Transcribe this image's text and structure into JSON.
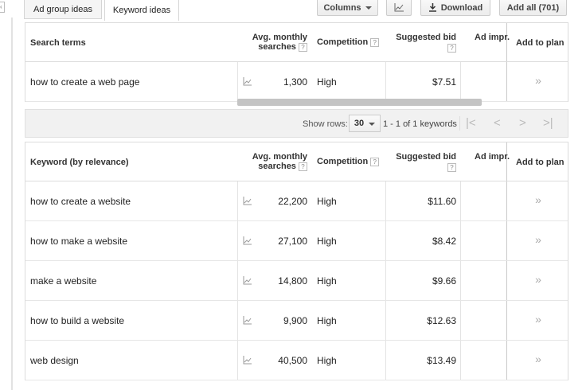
{
  "toolbar": {
    "tabs": [
      {
        "label": "Ad group ideas",
        "active": false
      },
      {
        "label": "Keyword ideas",
        "active": true
      }
    ],
    "columns_label": "Columns",
    "download_label": "Download",
    "add_all_label": "Add all (701)"
  },
  "search_table": {
    "headers": {
      "keyword": "Search terms",
      "volume_line1": "Avg. monthly",
      "volume_line2": "searches",
      "competition": "Competition",
      "bid": "Suggested bid",
      "impr": "Ad impr.",
      "add": "Add to plan",
      "help": "?"
    },
    "rows": [
      {
        "keyword": "how to create a web page",
        "volume": "1,300",
        "competition": "High",
        "bid": "$7.51",
        "add": "»"
      }
    ]
  },
  "pager": {
    "show_rows_label": "Show rows:",
    "rows_value": "30",
    "range": "1 - 1 of 1 keywords",
    "first": "|<",
    "prev": "<",
    "next": ">",
    "last": ">|"
  },
  "keyword_table": {
    "headers": {
      "keyword": "Keyword (by relevance)",
      "volume_line1": "Avg. monthly",
      "volume_line2": "searches",
      "competition": "Competition",
      "bid": "Suggested bid",
      "impr": "Ad impr.",
      "add": "Add to plan",
      "help": "?"
    },
    "rows": [
      {
        "keyword": "how to create a website",
        "volume": "22,200",
        "competition": "High",
        "bid": "$11.60",
        "add": "»"
      },
      {
        "keyword": "how to make a website",
        "volume": "27,100",
        "competition": "High",
        "bid": "$8.42",
        "add": "»"
      },
      {
        "keyword": "make a website",
        "volume": "14,800",
        "competition": "High",
        "bid": "$9.66",
        "add": "»"
      },
      {
        "keyword": "how to build a website",
        "volume": "9,900",
        "competition": "High",
        "bid": "$12.63",
        "add": "»"
      },
      {
        "keyword": "web design",
        "volume": "40,500",
        "competition": "High",
        "bid": "$13.49",
        "add": "»"
      }
    ]
  },
  "icons": {
    "trend": "trend-chart-icon",
    "download": "download-icon",
    "chart": "line-chart-icon"
  }
}
